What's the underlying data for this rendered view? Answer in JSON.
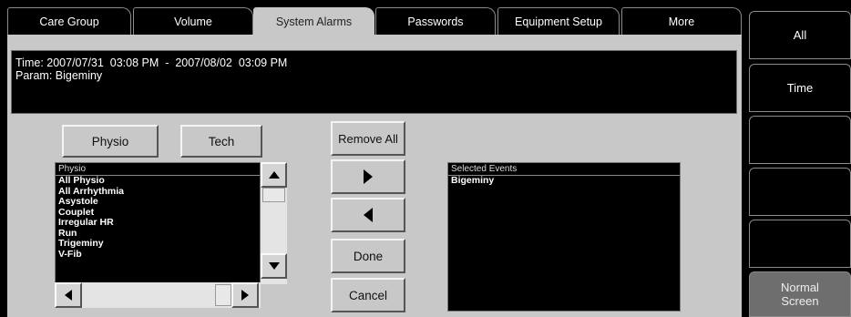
{
  "tabs": [
    "Care Group",
    "Volume",
    "System Alarms",
    "Passwords",
    "Equipment Setup",
    "More"
  ],
  "info": {
    "time_line": "Time: 2007/07/31  03:08 PM  -  2007/08/02  03:09 PM",
    "param_line": "Param: Bigeminy"
  },
  "filter_buttons": {
    "physio": "Physio",
    "tech": "Tech"
  },
  "source_list": {
    "header": "Physio",
    "items": [
      "All Physio",
      "All Arrhythmia",
      "Asystole",
      "Couplet",
      "Irregular HR",
      "Run",
      "Trigeminy",
      "V-Fib"
    ],
    "scroll_position": 0.0
  },
  "actions": {
    "remove_all": "Remove All",
    "add_icon": "triangle-right-icon",
    "remove_icon": "triangle-left-icon",
    "done": "Done",
    "cancel": "Cancel"
  },
  "selected_list": {
    "header": "Selected Events",
    "items": [
      "Bigeminy"
    ]
  },
  "sidebar": {
    "all": "All",
    "time": "Time",
    "blank1": "",
    "blank2": "",
    "blank3": "",
    "normal_screen": "Normal\nScreen"
  },
  "colors": {
    "panel": "#c8c8c8",
    "active_tab": "#c8c8c8",
    "background": "#000000",
    "normal_screen": "#6e6e6e"
  }
}
